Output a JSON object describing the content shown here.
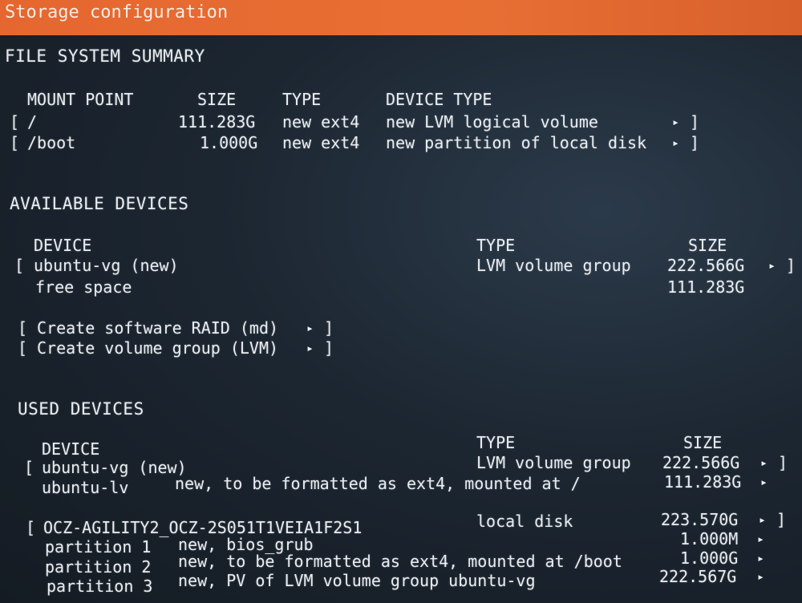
{
  "window": {
    "title": "Storage configuration"
  },
  "fs_summary": {
    "heading": "FILE SYSTEM SUMMARY",
    "columns": [
      "MOUNT POINT",
      "SIZE",
      "TYPE",
      "DEVICE TYPE"
    ],
    "rows": [
      {
        "open": "[",
        "mount": "/",
        "size": "111.283G",
        "type": "new ext4",
        "device_type": "new LVM logical volume",
        "arrow": "▸",
        "close": "]"
      },
      {
        "open": "[",
        "mount": "/boot",
        "size": "1.000G",
        "type": "new ext4",
        "device_type": "new partition of local disk",
        "arrow": "▸",
        "close": "]"
      }
    ]
  },
  "available": {
    "heading": "AVAILABLE DEVICES",
    "columns": [
      "DEVICE",
      "TYPE",
      "SIZE"
    ],
    "vg": {
      "open": "[",
      "name": "ubuntu-vg (new)",
      "type": "LVM volume group",
      "size": "222.566G",
      "arrow": "▸",
      "close": "]"
    },
    "free": {
      "label": "free space",
      "size": "111.283G"
    },
    "actions": [
      {
        "open": "[",
        "label": "Create software RAID (md)",
        "arrow": "▸",
        "close": "]"
      },
      {
        "open": "[",
        "label": "Create volume group (LVM)",
        "arrow": "▸",
        "close": "]"
      }
    ]
  },
  "used": {
    "heading": "USED DEVICES",
    "columns": [
      "DEVICE",
      "TYPE",
      "SIZE"
    ],
    "vg": {
      "open": "[",
      "name": "ubuntu-vg (new)",
      "type": "LVM volume group",
      "size": "222.566G",
      "arrow": "▸",
      "close": "]"
    },
    "lv": {
      "name": "ubuntu-lv",
      "desc": "new, to be formatted as ext4, mounted at /",
      "size": "111.283G",
      "arrow": "▸"
    },
    "disk": {
      "open": "[",
      "name": "OCZ-AGILITY2_OCZ-2S051T1VEIA1F2S1",
      "type": "local disk",
      "size": "223.570G",
      "arrow": "▸",
      "close": "]"
    },
    "partitions": [
      {
        "name": "partition 1",
        "desc": "new, bios_grub",
        "size": "1.000M",
        "arrow": "▸"
      },
      {
        "name": "partition 2",
        "desc": "new, to be formatted as ext4, mounted at /boot",
        "size": "1.000G",
        "arrow": "▸"
      },
      {
        "name": "partition 3",
        "desc": "new, PV of LVM volume group ubuntu-vg",
        "size": "222.567G",
        "arrow": "▸"
      }
    ]
  }
}
